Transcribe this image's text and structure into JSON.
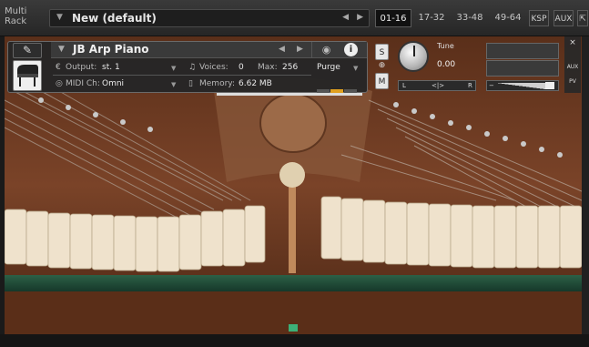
{
  "rack": {
    "label_line1": "Multi",
    "label_line2": "Rack",
    "title": "New (default)",
    "prev": "◀",
    "next": "▶",
    "pages": [
      "01-16",
      "17-32",
      "33-48",
      "49-64"
    ],
    "active_page": "01-16",
    "ksp_label": "KSP",
    "aux_label": "AUX"
  },
  "instrument": {
    "name": "JB Arp Piano",
    "output_label": "Output:",
    "output_value": "st. 1",
    "voices_label": "Voices:",
    "voices_value": "0",
    "max_label": "Max:",
    "max_value": "256",
    "purge_label": "Purge",
    "midi_label": "MIDI Ch:",
    "midi_value": "Omni",
    "memory_label": "Memory:",
    "memory_value": "6.62 MB",
    "info_label": "i",
    "solo_label": "S",
    "mute_label": "M",
    "tune_label": "Tune",
    "tune_value": "0.00",
    "pan_left": "L",
    "pan_center": "<|>",
    "pan_right": "R",
    "side_close": "×",
    "side_aux": "AUX",
    "side_pv": "PV"
  },
  "colors": {
    "wood": "#6b3b22",
    "felt_green": "#2f6a4a",
    "hammer": "#efe2cc",
    "purge_on": "#e0a020"
  },
  "icons": {
    "wrench": "wrench-icon",
    "piano": "grand-piano-icon",
    "camera": "camera-icon",
    "info": "info-icon",
    "midi": "midi-port-icon"
  }
}
